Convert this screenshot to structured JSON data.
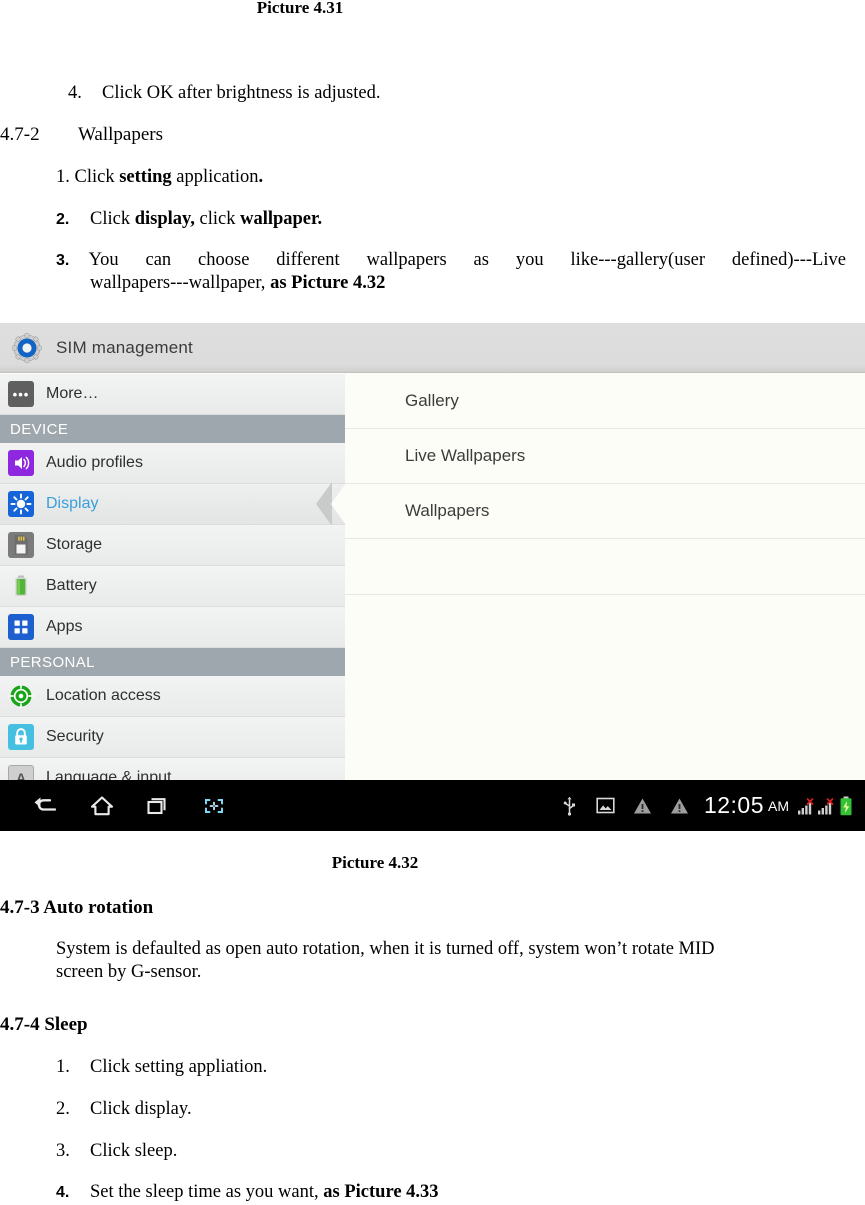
{
  "document": {
    "caption_top": "Picture 4.31",
    "caption_bottom": "Picture 4.32",
    "item_brightness_num": "4.",
    "item_brightness_text": "Click OK after brightness is adjusted.",
    "section_472_num": "4.7-2",
    "section_472_title": "Wallpapers",
    "step1_num": "1.",
    "step1_a": "Click ",
    "step1_b": "setting",
    "step1_c": " application",
    "step1_d": ".",
    "step2_num": "2.",
    "step2_a": "Click ",
    "step2_b": "display,",
    "step2_c": " click ",
    "step2_d": "wallpaper.",
    "step3_num": "3.",
    "step3_words": [
      "You",
      "can",
      "choose",
      "different",
      "wallpapers",
      "as",
      "you",
      "like---gallery(user",
      "defined)---Live"
    ],
    "step3_line2_a": "wallpapers---wallpaper, ",
    "step3_line2_b": "as Picture 4.32",
    "section_473": "4.7-3 Auto rotation",
    "para_473_line1": "System is defaulted as open auto rotation, when it is turned off, system won’t rotate MID",
    "para_473_line2": "screen by G-sensor.",
    "section_474": "4.7-4 Sleep",
    "sleep_steps": [
      {
        "num": "1.",
        "text": "Click setting appliation."
      },
      {
        "num": "2.",
        "text": "Click display."
      },
      {
        "num": "3.",
        "text": "Click sleep."
      }
    ],
    "sleep_step4_num": "4.",
    "sleep_step4_a": "Set the sleep time as you want, ",
    "sleep_step4_b": "as Picture 4.33"
  },
  "android": {
    "header": {
      "icon": "sim-gear-icon",
      "title": "SIM management"
    },
    "sidebar": [
      {
        "type": "item",
        "label": "More…",
        "icon": "more-icon",
        "icon_color": "#5f5f5f",
        "glyph": "•••",
        "selected": false
      },
      {
        "type": "header",
        "label": "DEVICE"
      },
      {
        "type": "item",
        "label": "Audio profiles",
        "icon": "speaker-icon",
        "icon_color": "#8d28e0",
        "glyph": "◂)",
        "selected": false
      },
      {
        "type": "item",
        "label": "Display",
        "icon": "brightness-icon",
        "icon_color": "#1565d8",
        "glyph": "☀",
        "selected": true
      },
      {
        "type": "item",
        "label": "Storage",
        "icon": "sdcard-icon",
        "icon_color": "#7b7b7b",
        "glyph": "",
        "selected": false
      },
      {
        "type": "item",
        "label": "Battery",
        "icon": "battery-icon",
        "icon_color": "#54b33a",
        "glyph": "",
        "selected": false
      },
      {
        "type": "item",
        "label": "Apps",
        "icon": "grid-apps-icon",
        "icon_color": "#1e5fd0",
        "glyph": "",
        "selected": false
      },
      {
        "type": "header",
        "label": "PERSONAL"
      },
      {
        "type": "item",
        "label": "Location access",
        "icon": "location-target-icon",
        "icon_color": "#17a817",
        "glyph": "",
        "selected": false
      },
      {
        "type": "item",
        "label": "Security",
        "icon": "lock-icon",
        "icon_color": "#46c0e0",
        "glyph": "",
        "selected": false
      },
      {
        "type": "item",
        "label": "Language & input",
        "icon": "letter-a-icon",
        "icon_color": "#cfcfcf",
        "glyph": "A",
        "selected": false
      }
    ],
    "detail_title": "",
    "detail_rows": [
      {
        "label": "Gallery"
      },
      {
        "label": "Live Wallpapers"
      },
      {
        "label": "Wallpapers"
      }
    ],
    "navbar": {
      "buttons": [
        {
          "name": "back-icon",
          "label": "back"
        },
        {
          "name": "home-icon",
          "label": "home"
        },
        {
          "name": "recents-icon",
          "label": "recent apps"
        },
        {
          "name": "screenshot-icon",
          "label": "screenshot"
        }
      ],
      "status": {
        "usb": "usb-icon",
        "screenshot_image": "image-icon",
        "warning1": "warning-triangle-icon",
        "warning2": "warning-triangle-icon",
        "time": "12:05",
        "meridiem": "AM",
        "signal1": "signal-no-sim-icon",
        "signal2": "signal-no-sim-icon",
        "battery": "battery-charging-icon"
      }
    },
    "colors": {
      "header_bg": "#dcdcdc",
      "sidebar_bg": "#eceded",
      "section_header_bg": "#9ea7ad",
      "detail_bg": "#fdfdf7",
      "accent_selected_text": "#3a9fdc",
      "navbar_bg": "#000000"
    }
  }
}
